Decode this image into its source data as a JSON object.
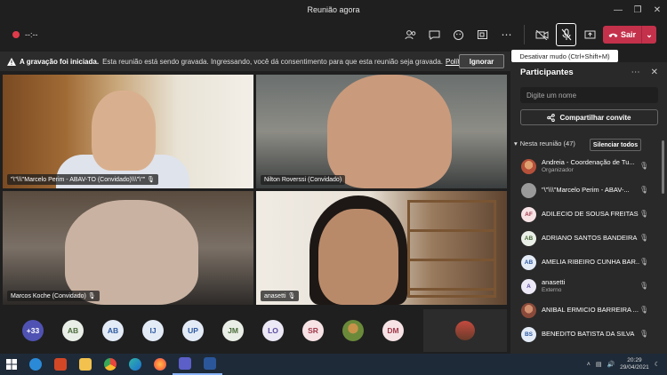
{
  "window": {
    "title": "Reunião agora",
    "controls": [
      "—",
      "❐",
      "✕"
    ]
  },
  "toolbar": {
    "timer": "--:--",
    "icons": [
      "people-icon",
      "chat-icon",
      "reactions-icon",
      "rooms-icon",
      "more-icon",
      "camera-off-icon",
      "mic-off-icon",
      "share-icon"
    ],
    "leave_label": "Sair",
    "tooltip": "Desativar mudo (Ctrl+Shift+M)"
  },
  "banner": {
    "title": "A gravação foi iniciada.",
    "text": "Esta reunião está sendo gravada. Ingressando, você dá consentimento para que esta reunião seja gravada.",
    "link": "Política ...",
    "ignore_label": "Ignorar"
  },
  "videos": [
    {
      "label": "\"\\\"\\\\\\\"Marcelo Perim - ABAV-TO (Convidado)\\\\\\\"\\\"\""
    },
    {
      "label": "Nilton Roverssi (Convidado)"
    },
    {
      "label": "Marcos Koche (Convidado)"
    },
    {
      "label": "anasetti"
    }
  ],
  "strip": {
    "more_count": "+33",
    "avatars": [
      {
        "initials": "AB",
        "bg": "#e9efe6",
        "fg": "#4a6b3a"
      },
      {
        "initials": "AB",
        "bg": "#e3ebf7",
        "fg": "#2f5aa0"
      },
      {
        "initials": "IJ",
        "bg": "#e3ebf7",
        "fg": "#2f5aa0"
      },
      {
        "initials": "UP",
        "bg": "#e3ebf7",
        "fg": "#2f5aa0"
      },
      {
        "initials": "JM",
        "bg": "#e9efe6",
        "fg": "#4a6b3a"
      },
      {
        "initials": "LO",
        "bg": "#ece8f6",
        "fg": "#5b4aa0"
      },
      {
        "initials": "SR",
        "bg": "#f7e3e6",
        "fg": "#a03a4a"
      },
      {
        "initials": "",
        "bg": "#8a6a3a",
        "fg": "#fff"
      },
      {
        "initials": "DM",
        "bg": "#f7e3e6",
        "fg": "#a03a4a"
      }
    ]
  },
  "participants": {
    "title": "Participantes",
    "search_placeholder": "Digite um nome",
    "share_label": "Compartilhar convite",
    "in_meeting": "Nesta reunião (47)",
    "mute_all_label": "Silenciar todos",
    "list": [
      {
        "initials": "",
        "name": "Andreia - Coordenação de Tu...",
        "role": "Organizador",
        "bg": "#b5503a",
        "fg": "#fff"
      },
      {
        "initials": "",
        "name": "\"\\\"\\\\\\\"Marcelo Perim - ABAV-...",
        "role": "",
        "bg": "#9a9a9a",
        "fg": "#fff"
      },
      {
        "initials": "AF",
        "name": "ADILECIO DE SOUSA FREITAS",
        "role": "",
        "bg": "#f7e3e6",
        "fg": "#a03a4a"
      },
      {
        "initials": "AB",
        "name": "ADRIANO SANTOS BANDEIRA",
        "role": "",
        "bg": "#e9efe6",
        "fg": "#4a6b3a"
      },
      {
        "initials": "AB",
        "name": "AMELIA RIBEIRO CUNHA BAR...",
        "role": "",
        "bg": "#e3ebf7",
        "fg": "#2f5aa0"
      },
      {
        "initials": "A",
        "name": "anasetti",
        "role": "Externo",
        "bg": "#ece8f6",
        "fg": "#5b4aa0"
      },
      {
        "initials": "",
        "name": "ANIBAL ERMICIO BARREIRA ...",
        "role": "",
        "bg": "#8a4a3a",
        "fg": "#fff"
      },
      {
        "initials": "BS",
        "name": "BENEDITO BATISTA DA SILVA",
        "role": "",
        "bg": "#e3ebf7",
        "fg": "#2f5aa0"
      }
    ]
  },
  "taskbar": {
    "apps": [
      {
        "name": "edge-legacy-icon",
        "color": "#2a8ad8"
      },
      {
        "name": "powerpoint-icon",
        "color": "#d24726"
      },
      {
        "name": "file-explorer-icon",
        "color": "#f2c14e"
      },
      {
        "name": "chrome-icon",
        "color": "#e8453c"
      },
      {
        "name": "edge-icon",
        "color": "#2fb5a8"
      },
      {
        "name": "firefox-icon",
        "color": "#ff7139"
      },
      {
        "name": "teams-icon",
        "color": "#5b5fc7"
      },
      {
        "name": "word-icon",
        "color": "#2b579a"
      }
    ],
    "time": "20:29",
    "date": "29/04/2021"
  }
}
